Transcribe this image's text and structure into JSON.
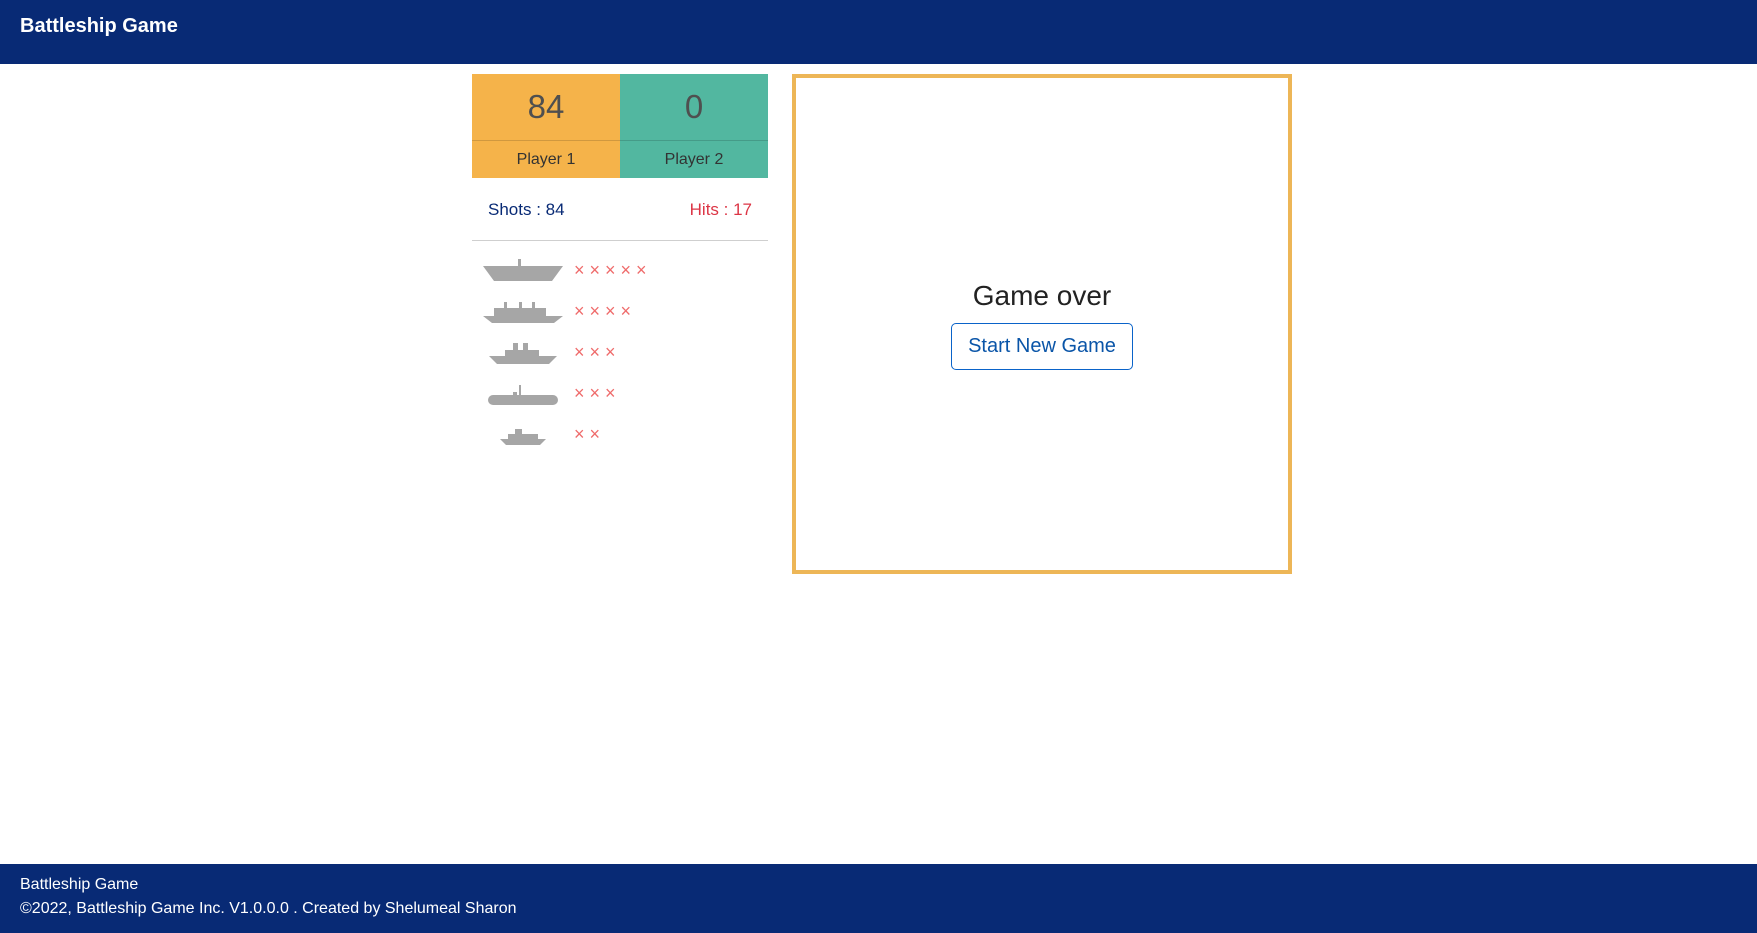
{
  "app": {
    "title": "Battleship Game"
  },
  "scoreboard": {
    "player1": {
      "score": "84",
      "label": "Player 1",
      "color": "#f5b34a"
    },
    "player2": {
      "score": "0",
      "label": "Player 2",
      "color": "#52b7a0"
    }
  },
  "stats": {
    "shots": "Shots : 84",
    "hits": "Hits : 17"
  },
  "fleet": {
    "hit_mark_color": "#ef6b6b",
    "ships": [
      {
        "icon": "battleship-icon",
        "hits": 5,
        "marks": "×××××"
      },
      {
        "icon": "carrier-icon",
        "hits": 4,
        "marks": "××××"
      },
      {
        "icon": "cruiser-icon",
        "hits": 3,
        "marks": "×××"
      },
      {
        "icon": "submarine-icon",
        "hits": 3,
        "marks": "×××"
      },
      {
        "icon": "destroyer-icon",
        "hits": 2,
        "marks": "××"
      }
    ]
  },
  "board": {
    "border_color": "#edb657",
    "message": "Game over",
    "new_game_label": "Start New Game"
  },
  "footer": {
    "title": "Battleship Game",
    "copyright": "©2022, Battleship Game Inc. V1.0.0.0 . Created by Shelumeal Sharon"
  },
  "colors": {
    "navbar": "#082a75",
    "hits_text": "#dc3545",
    "shots_text": "#082a75",
    "ship_gray": "#a6a6a6"
  }
}
